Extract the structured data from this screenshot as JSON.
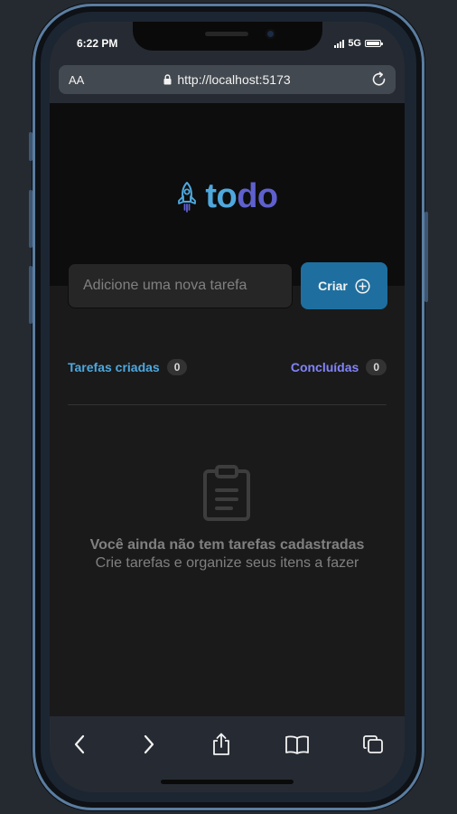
{
  "status": {
    "time": "6:22 PM",
    "network": "5G"
  },
  "browser": {
    "text_size_label": "AA",
    "url": "http://localhost:5173"
  },
  "app": {
    "logo_part1": "to",
    "logo_part2": "do",
    "input_placeholder": "Adicione uma nova tarefa",
    "input_value": "",
    "create_label": "Criar",
    "created_label": "Tarefas criadas",
    "created_count": "0",
    "done_label": "Concluídas",
    "done_count": "0",
    "empty_title": "Você ainda não tem tarefas cadastradas",
    "empty_subtitle": "Crie tarefas e organize seus itens a fazer"
  },
  "toolbar": {
    "items": [
      {
        "icon": "back-icon"
      },
      {
        "icon": "forward-icon"
      },
      {
        "icon": "share-icon"
      },
      {
        "icon": "bookmarks-icon"
      },
      {
        "icon": "tabs-icon"
      }
    ]
  },
  "colors": {
    "blue": "#4ea8de",
    "blue_dark": "#1e6f9f",
    "purple": "#5e60ce",
    "purple_light": "#8284fa",
    "gray_300": "#808080"
  }
}
